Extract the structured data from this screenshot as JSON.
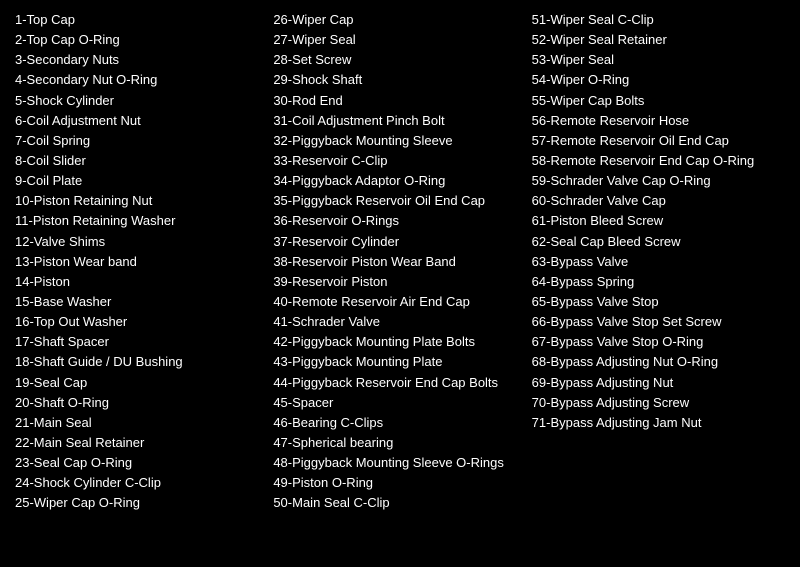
{
  "columns": [
    {
      "items": [
        "1-Top Cap",
        "2-Top Cap O-Ring",
        "3-Secondary Nuts",
        "4-Secondary Nut O-Ring",
        "5-Shock Cylinder",
        "6-Coil Adjustment Nut",
        "7-Coil Spring",
        "8-Coil Slider",
        "9-Coil Plate",
        "10-Piston Retaining Nut",
        "11-Piston Retaining Washer",
        "12-Valve Shims",
        "13-Piston Wear band",
        "14-Piston",
        "15-Base Washer",
        "16-Top Out Washer",
        "17-Shaft Spacer",
        "18-Shaft Guide / DU Bushing",
        "19-Seal Cap",
        "20-Shaft O-Ring",
        "21-Main Seal",
        "22-Main Seal Retainer",
        "23-Seal Cap O-Ring",
        "24-Shock Cylinder C-Clip",
        "25-Wiper Cap O-Ring"
      ]
    },
    {
      "items": [
        "26-Wiper Cap",
        "27-Wiper Seal",
        "28-Set Screw",
        "29-Shock Shaft",
        "30-Rod End",
        "31-Coil Adjustment Pinch Bolt",
        "32-Piggyback Mounting Sleeve",
        "33-Reservoir C-Clip",
        "34-Piggyback Adaptor O-Ring",
        "35-Piggyback Reservoir Oil End Cap",
        "36-Reservoir O-Rings",
        "37-Reservoir Cylinder",
        "38-Reservoir Piston Wear Band",
        "39-Reservoir Piston",
        "40-Remote Reservoir Air End Cap",
        "41-Schrader Valve",
        "42-Piggyback Mounting Plate Bolts",
        "43-Piggyback Mounting Plate",
        "44-Piggyback Reservoir End Cap Bolts",
        "45-Spacer",
        "46-Bearing C-Clips",
        "47-Spherical bearing",
        "48-Piggyback Mounting Sleeve O-Rings",
        "49-Piston O-Ring",
        "50-Main Seal C-Clip"
      ]
    },
    {
      "items": [
        "51-Wiper Seal C-Clip",
        "52-Wiper Seal Retainer",
        "53-Wiper Seal",
        "54-Wiper O-Ring",
        "55-Wiper Cap Bolts",
        "56-Remote Reservoir Hose",
        "57-Remote Reservoir Oil End Cap",
        "58-Remote Reservoir End Cap O-Ring",
        "59-Schrader Valve Cap O-Ring",
        "60-Schrader Valve Cap",
        "61-Piston Bleed Screw",
        "62-Seal Cap Bleed Screw",
        "63-Bypass Valve",
        "64-Bypass Spring",
        "65-Bypass Valve Stop",
        "66-Bypass Valve Stop Set Screw",
        "67-Bypass Valve Stop O-Ring",
        "68-Bypass Adjusting Nut O-Ring",
        "69-Bypass Adjusting Nut",
        "70-Bypass Adjusting Screw",
        "71-Bypass Adjusting Jam Nut"
      ]
    }
  ]
}
